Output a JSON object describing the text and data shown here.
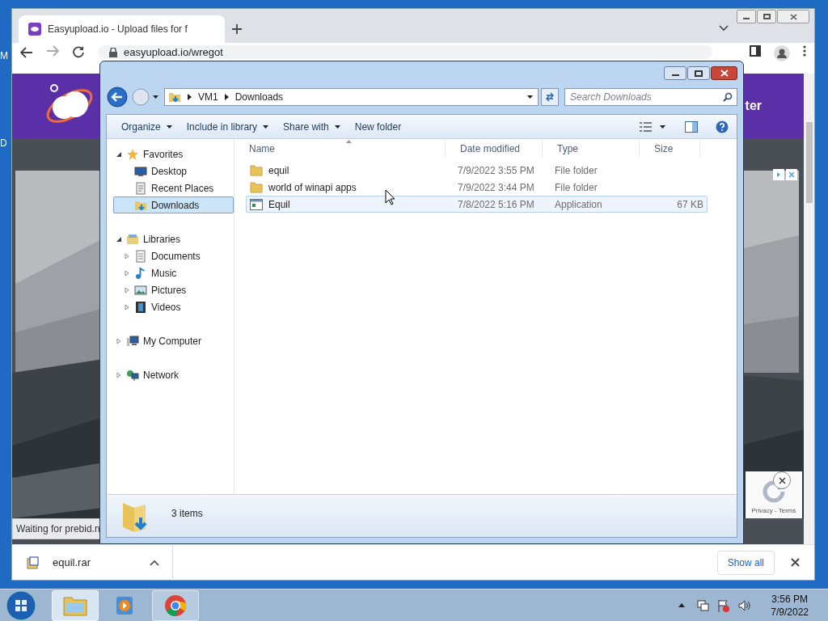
{
  "desktop": {
    "icon_labels": [
      "M",
      "D"
    ]
  },
  "browser": {
    "tab_title": "Easyupload.io - Upload files for f",
    "address": "easyupload.io/wregot",
    "header_text": "ter",
    "status": "Waiting for prebid.n",
    "recaptcha": "Privacy - Terms",
    "download": "equil.rar",
    "show_all": "Show all"
  },
  "explorer": {
    "breadcrumb": [
      "VM1",
      "Downloads"
    ],
    "search": {
      "placeholder": "Search Downloads"
    },
    "toolbar": [
      {
        "label": "Organize",
        "dropdown": true
      },
      {
        "label": "Include in library",
        "dropdown": true
      },
      {
        "label": "Share with",
        "dropdown": true
      },
      {
        "label": "New folder",
        "dropdown": false
      }
    ],
    "nav": [
      {
        "label": "Favorites",
        "kind": "star",
        "expanded": true,
        "children": [
          {
            "label": "Desktop",
            "kind": "desktop",
            "selected": false
          },
          {
            "label": "Recent Places",
            "kind": "recent",
            "selected": false
          },
          {
            "label": "Downloads",
            "kind": "downloads",
            "selected": true
          }
        ]
      },
      {
        "label": "Libraries",
        "kind": "library",
        "expanded": true,
        "children": [
          {
            "label": "Documents",
            "kind": "documents",
            "expanded": false,
            "selected": false
          },
          {
            "label": "Music",
            "kind": "music",
            "expanded": false,
            "selected": false
          },
          {
            "label": "Pictures",
            "kind": "pictures",
            "expanded": false,
            "selected": false
          },
          {
            "label": "Videos",
            "kind": "videos",
            "expanded": false,
            "selected": false
          }
        ]
      },
      {
        "label": "My Computer",
        "kind": "computer",
        "expanded": false
      },
      {
        "label": "Network",
        "kind": "network",
        "expanded": false
      }
    ],
    "columns": [
      "Name",
      "Date modified",
      "Type",
      "Size"
    ],
    "files": [
      {
        "name": "equil",
        "kind": "folder",
        "date": "7/9/2022 3:55 PM",
        "type": "File folder",
        "selected": false
      },
      {
        "name": "world of winapi apps",
        "kind": "folder",
        "date": "7/9/2022 3:44 PM",
        "type": "File folder",
        "selected": false
      },
      {
        "name": "Equil",
        "kind": "app",
        "date": "7/8/2022 5:16 PM",
        "type": "Application",
        "size": "67 KB",
        "selected": true
      }
    ],
    "status": "3 items"
  },
  "taskbar": {
    "apps": [
      {
        "kind": "explorer",
        "selected": true
      },
      {
        "kind": "media",
        "selected": false
      },
      {
        "kind": "chrome",
        "selected": false
      }
    ],
    "time": "3:56 PM",
    "date": "7/9/2022"
  }
}
